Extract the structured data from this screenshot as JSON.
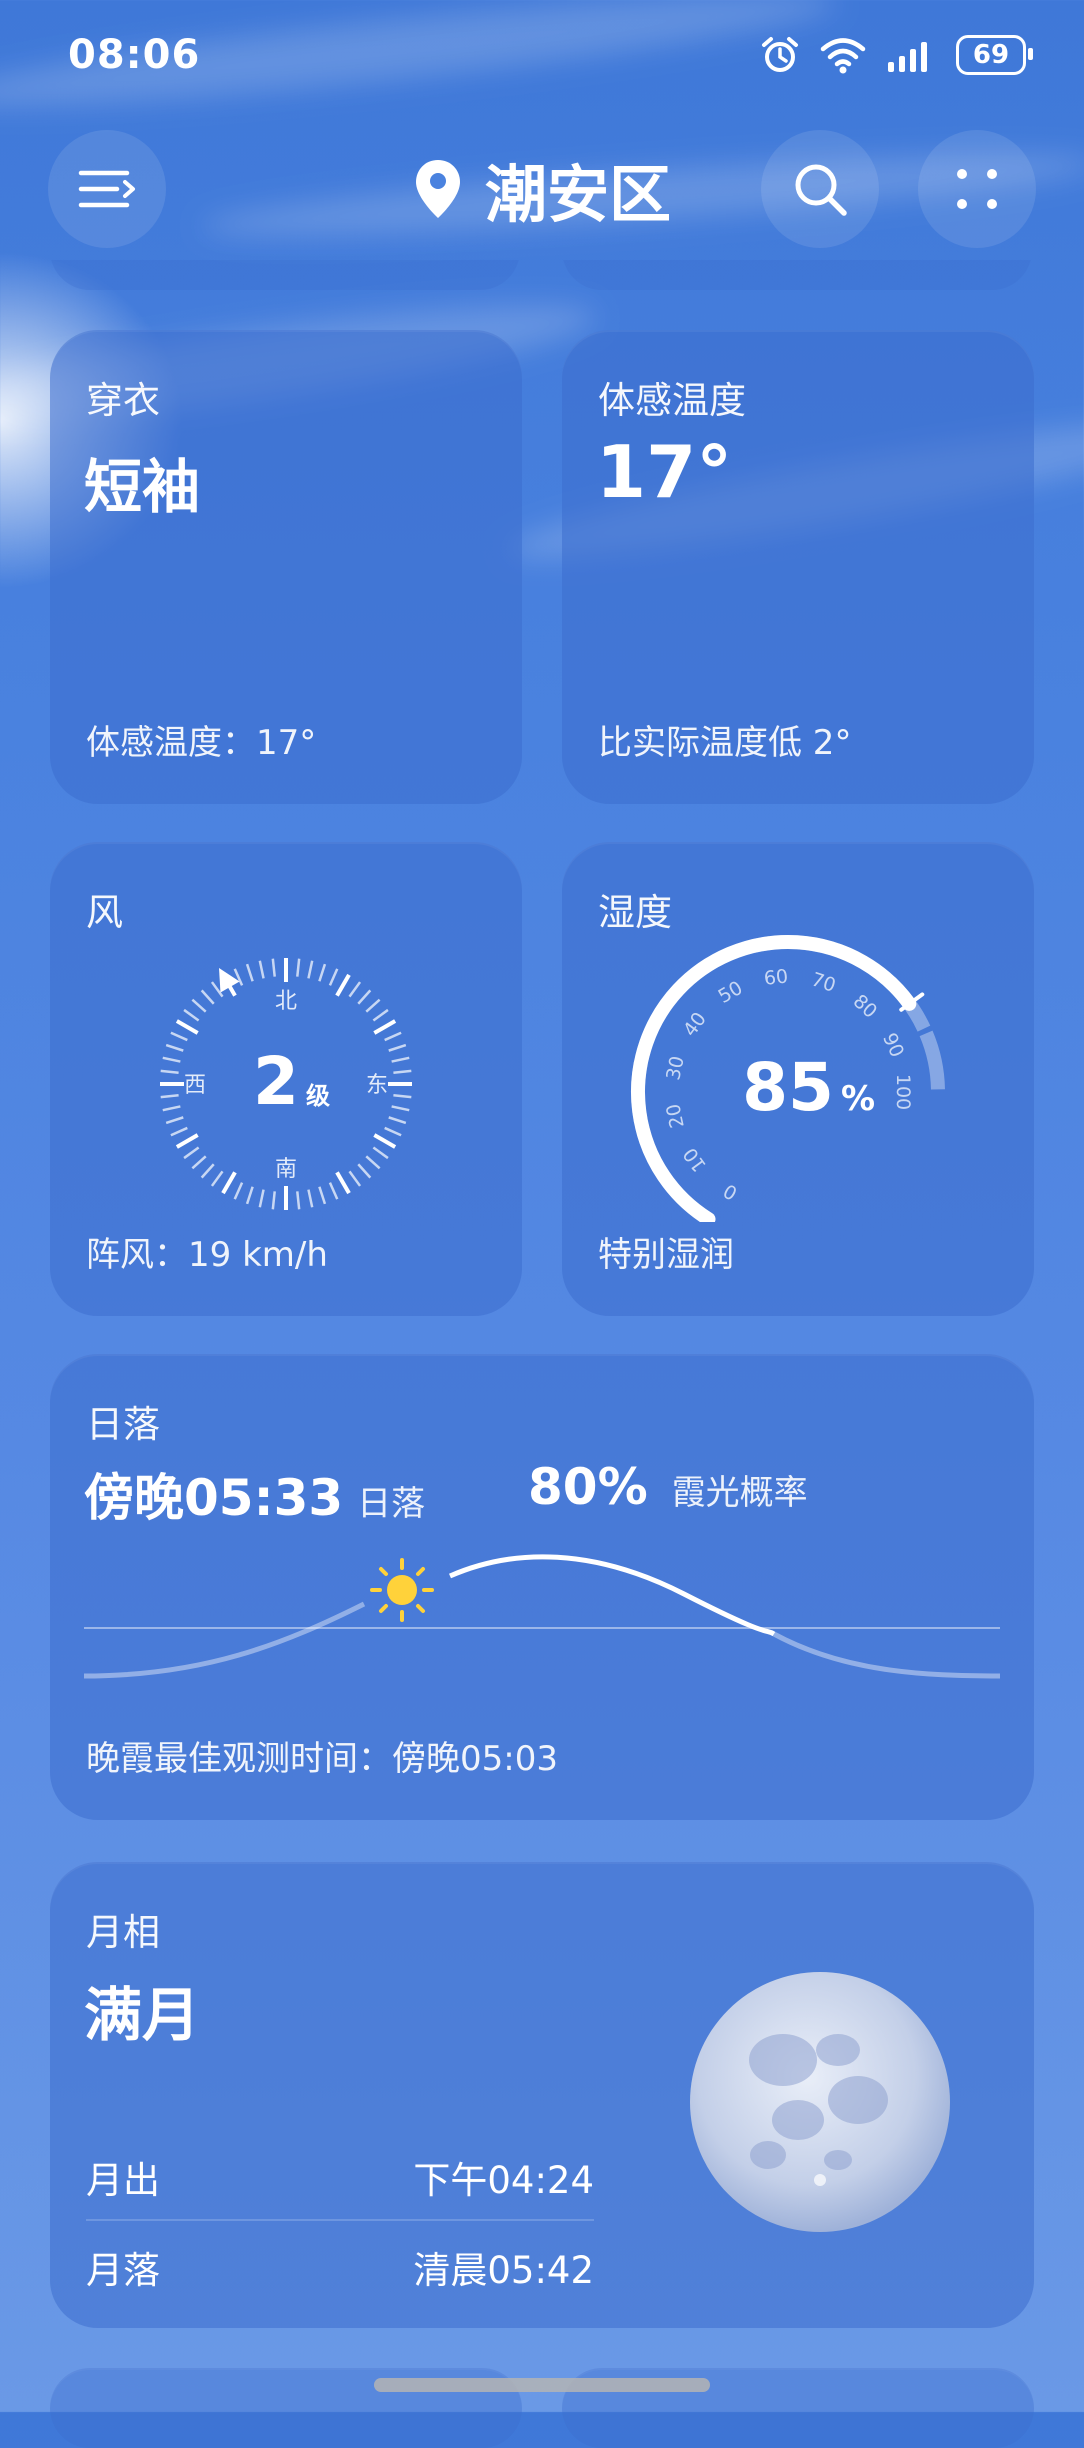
{
  "status_bar": {
    "time": "08:06",
    "battery": "69"
  },
  "header": {
    "city": "潮安区"
  },
  "clothing": {
    "title": "穿衣",
    "value": "短袖",
    "footer": "体感温度：17°"
  },
  "feels_like": {
    "title": "体感温度",
    "value": "17°",
    "footer": "比实际温度低 2°"
  },
  "wind": {
    "title": "风",
    "level": "2",
    "level_unit": "级",
    "north": "北",
    "south": "南",
    "east": "东",
    "west": "西",
    "footer": "阵风：19 km/h",
    "direction_deg": 330
  },
  "humidity": {
    "title": "湿度",
    "value": "85",
    "unit": "%",
    "footer": "特别湿润",
    "ticks": [
      "0",
      "10",
      "20",
      "30",
      "40",
      "50",
      "60",
      "70",
      "80",
      "90",
      "100"
    ],
    "level": 0.85
  },
  "sunset": {
    "title": "日落",
    "time": "傍晚05:33",
    "time_label": "日落",
    "glow_prob": "80%",
    "glow_label": "霞光概率",
    "footer": "晚霞最佳观测时间：傍晚05:03"
  },
  "moon": {
    "title": "月相",
    "phase": "满月",
    "rise_label": "月出",
    "rise_time": "下午04:24",
    "set_label": "月落",
    "set_time": "清晨05:42"
  },
  "colors": {
    "sun": "#ffd23a",
    "card": "#3c6ecd",
    "bg_top": "#3f78d8"
  }
}
